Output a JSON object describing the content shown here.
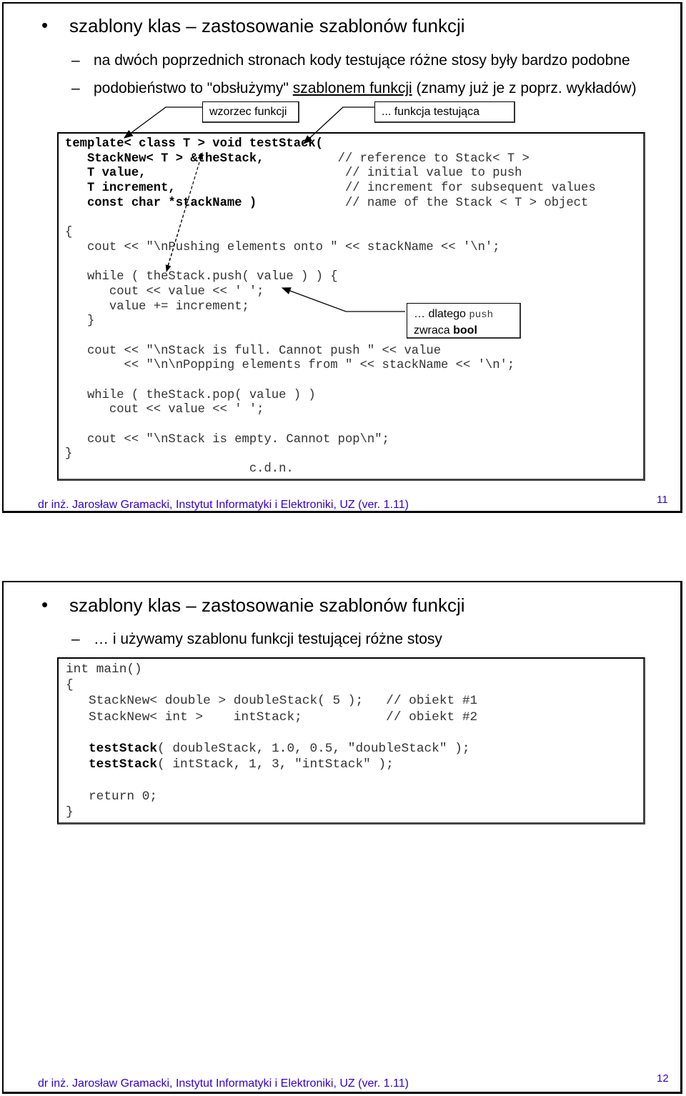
{
  "slides": [
    {
      "title": "szablony klas – zastosowanie szablonów funkcji",
      "bullets": [
        {
          "text": "na dwóch poprzednich stronach kody testujące różne stosy były bardzo podobne"
        },
        {
          "pre": "podobieństwo to \"obsłużymy\" ",
          "link": "szablonem funkcji",
          "post": " (znamy już je z poprz. wykładów)"
        }
      ],
      "callouts": {
        "template": "wzorzec funkcji",
        "test": "... funkcja testująca",
        "push_a": "… dlatego ",
        "push_code": "push",
        "push_b": "zwraca ",
        "push_bold": "bool"
      },
      "code": [
        {
          "b": "template< class T > void testStack(",
          "c": ""
        },
        {
          "b": "   StackNew< T > &theStack,",
          "c": "          // reference to Stack< T >"
        },
        {
          "b": "   T value,",
          "c": "                           // initial value to push"
        },
        {
          "b": "   T increment,",
          "c": "                       // increment for subsequent values"
        },
        {
          "b": "   const char *stackName )",
          "c": "            // name of the Stack < T > object"
        },
        {
          "b": "",
          "c": ""
        },
        {
          "b": "",
          "c": "{"
        },
        {
          "b": "",
          "c": "   cout << \"\\nPushing elements onto \" << stackName << '\\n';"
        },
        {
          "b": "",
          "c": ""
        },
        {
          "b": "",
          "c": "   while ( theStack.push( value ) ) {"
        },
        {
          "b": "",
          "c": "      cout << value << ' ';"
        },
        {
          "b": "",
          "c": "      value += increment;"
        },
        {
          "b": "",
          "c": "   }"
        },
        {
          "b": "",
          "c": ""
        },
        {
          "b": "",
          "c": "   cout << \"\\nStack is full. Cannot push \" << value"
        },
        {
          "b": "",
          "c": "        << \"\\n\\nPopping elements from \" << stackName << '\\n';"
        },
        {
          "b": "",
          "c": ""
        },
        {
          "b": "",
          "c": "   while ( theStack.pop( value ) )"
        },
        {
          "b": "",
          "c": "      cout << value << ' ';"
        },
        {
          "b": "",
          "c": ""
        },
        {
          "b": "",
          "c": "   cout << \"\\nStack is empty. Cannot pop\\n\";"
        },
        {
          "b": "",
          "c": "}"
        },
        {
          "b": "",
          "c": "                         c.d.n."
        }
      ],
      "footer": "dr inż. Jarosław Gramacki, Instytut Informatyki i Elektroniki, UZ (ver. 1.11)",
      "page": "11"
    },
    {
      "title": "szablony klas – zastosowanie szablonów funkcji",
      "bullets": [
        {
          "text": "… i używamy szablonu funkcji testującej różne stosy"
        }
      ],
      "code": [
        {
          "b": "",
          "c": "int main()"
        },
        {
          "b": "",
          "c": "{"
        },
        {
          "b": "",
          "c": "   StackNew< double > doubleStack( 5 );   // obiekt #1"
        },
        {
          "b": "",
          "c": "   StackNew< int >    intStack;           // obiekt #2"
        },
        {
          "b": "",
          "c": ""
        },
        {
          "b": "   testStack",
          "c": "( doubleStack, 1.0, 0.5, \"doubleStack\" );"
        },
        {
          "b": "   testStack",
          "c": "( intStack, 1, 3, \"intStack\" );"
        },
        {
          "b": "",
          "c": ""
        },
        {
          "b": "",
          "c": "   return 0;"
        },
        {
          "b": "",
          "c": "}"
        }
      ],
      "footer": "dr inż. Jarosław Gramacki, Instytut Informatyki i Elektroniki, UZ (ver. 1.11)",
      "page": "12"
    }
  ]
}
